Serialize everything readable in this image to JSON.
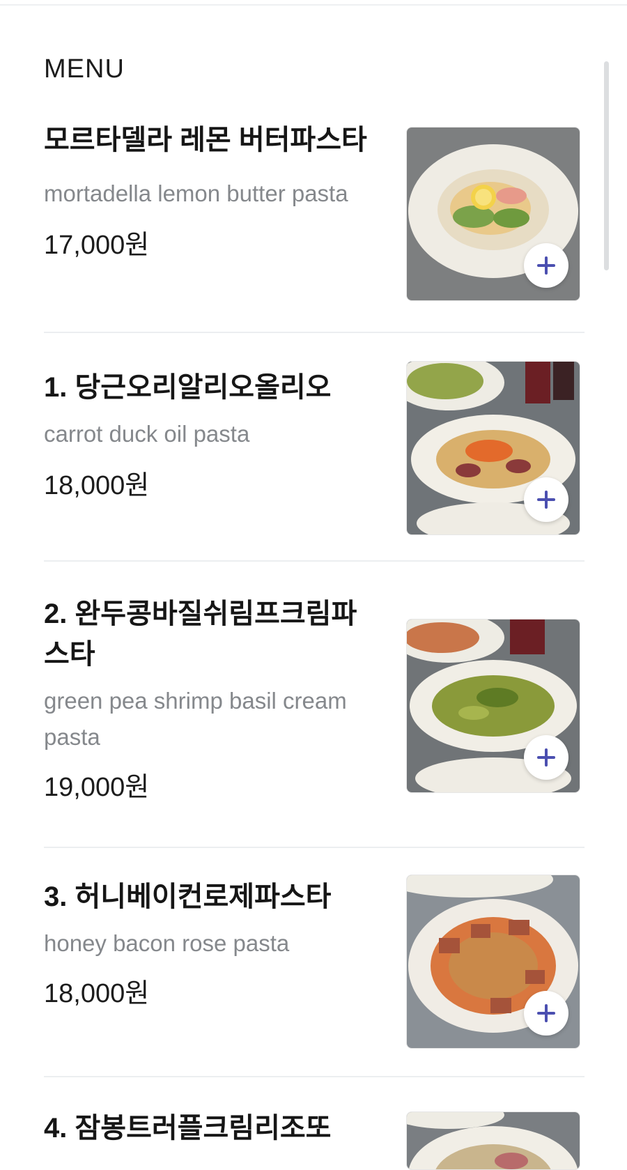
{
  "section": {
    "title": "MENU"
  },
  "menu": {
    "items": [
      {
        "name": "모르타델라 레몬 버터파스타",
        "description": "mortadella lemon butter pasta",
        "price": "17,000원",
        "photo_colors": {
          "plate": "#efece4",
          "food": "#e9c98a",
          "accent": "#f3d24a",
          "bg": "#7d7f80"
        }
      },
      {
        "name": "1. 당근오리알리오올리오",
        "description": "carrot duck oil pasta",
        "price": "18,000원",
        "photo_colors": {
          "plate": "#f2efe7",
          "food": "#d9b06c",
          "accent": "#e36a2b",
          "bg": "#6f7478"
        }
      },
      {
        "name": "2. 완두콩바질쉬림프크림파스타",
        "description": "green pea shrimp basil cream pasta",
        "price": "19,000원",
        "photo_colors": {
          "plate": "#f1eee6",
          "food": "#8a9a3a",
          "accent": "#5e7b24",
          "bg": "#707477"
        }
      },
      {
        "name": "3. 허니베이컨로제파스타",
        "description": "honey bacon rose pasta",
        "price": "18,000원",
        "photo_colors": {
          "plate": "#f0ece5",
          "food": "#d9773f",
          "accent": "#a5533a",
          "bg": "#8a9096"
        }
      },
      {
        "name": "4. 잠봉트러플크림리조또",
        "description": "",
        "price": "",
        "photo_colors": {
          "plate": "#f1eee6",
          "food": "#c9b58d",
          "accent": "#b86b6b",
          "bg": "#7a7e82"
        }
      }
    ],
    "add_icon": "plus-icon",
    "accent_color": "#4b4fb0"
  }
}
